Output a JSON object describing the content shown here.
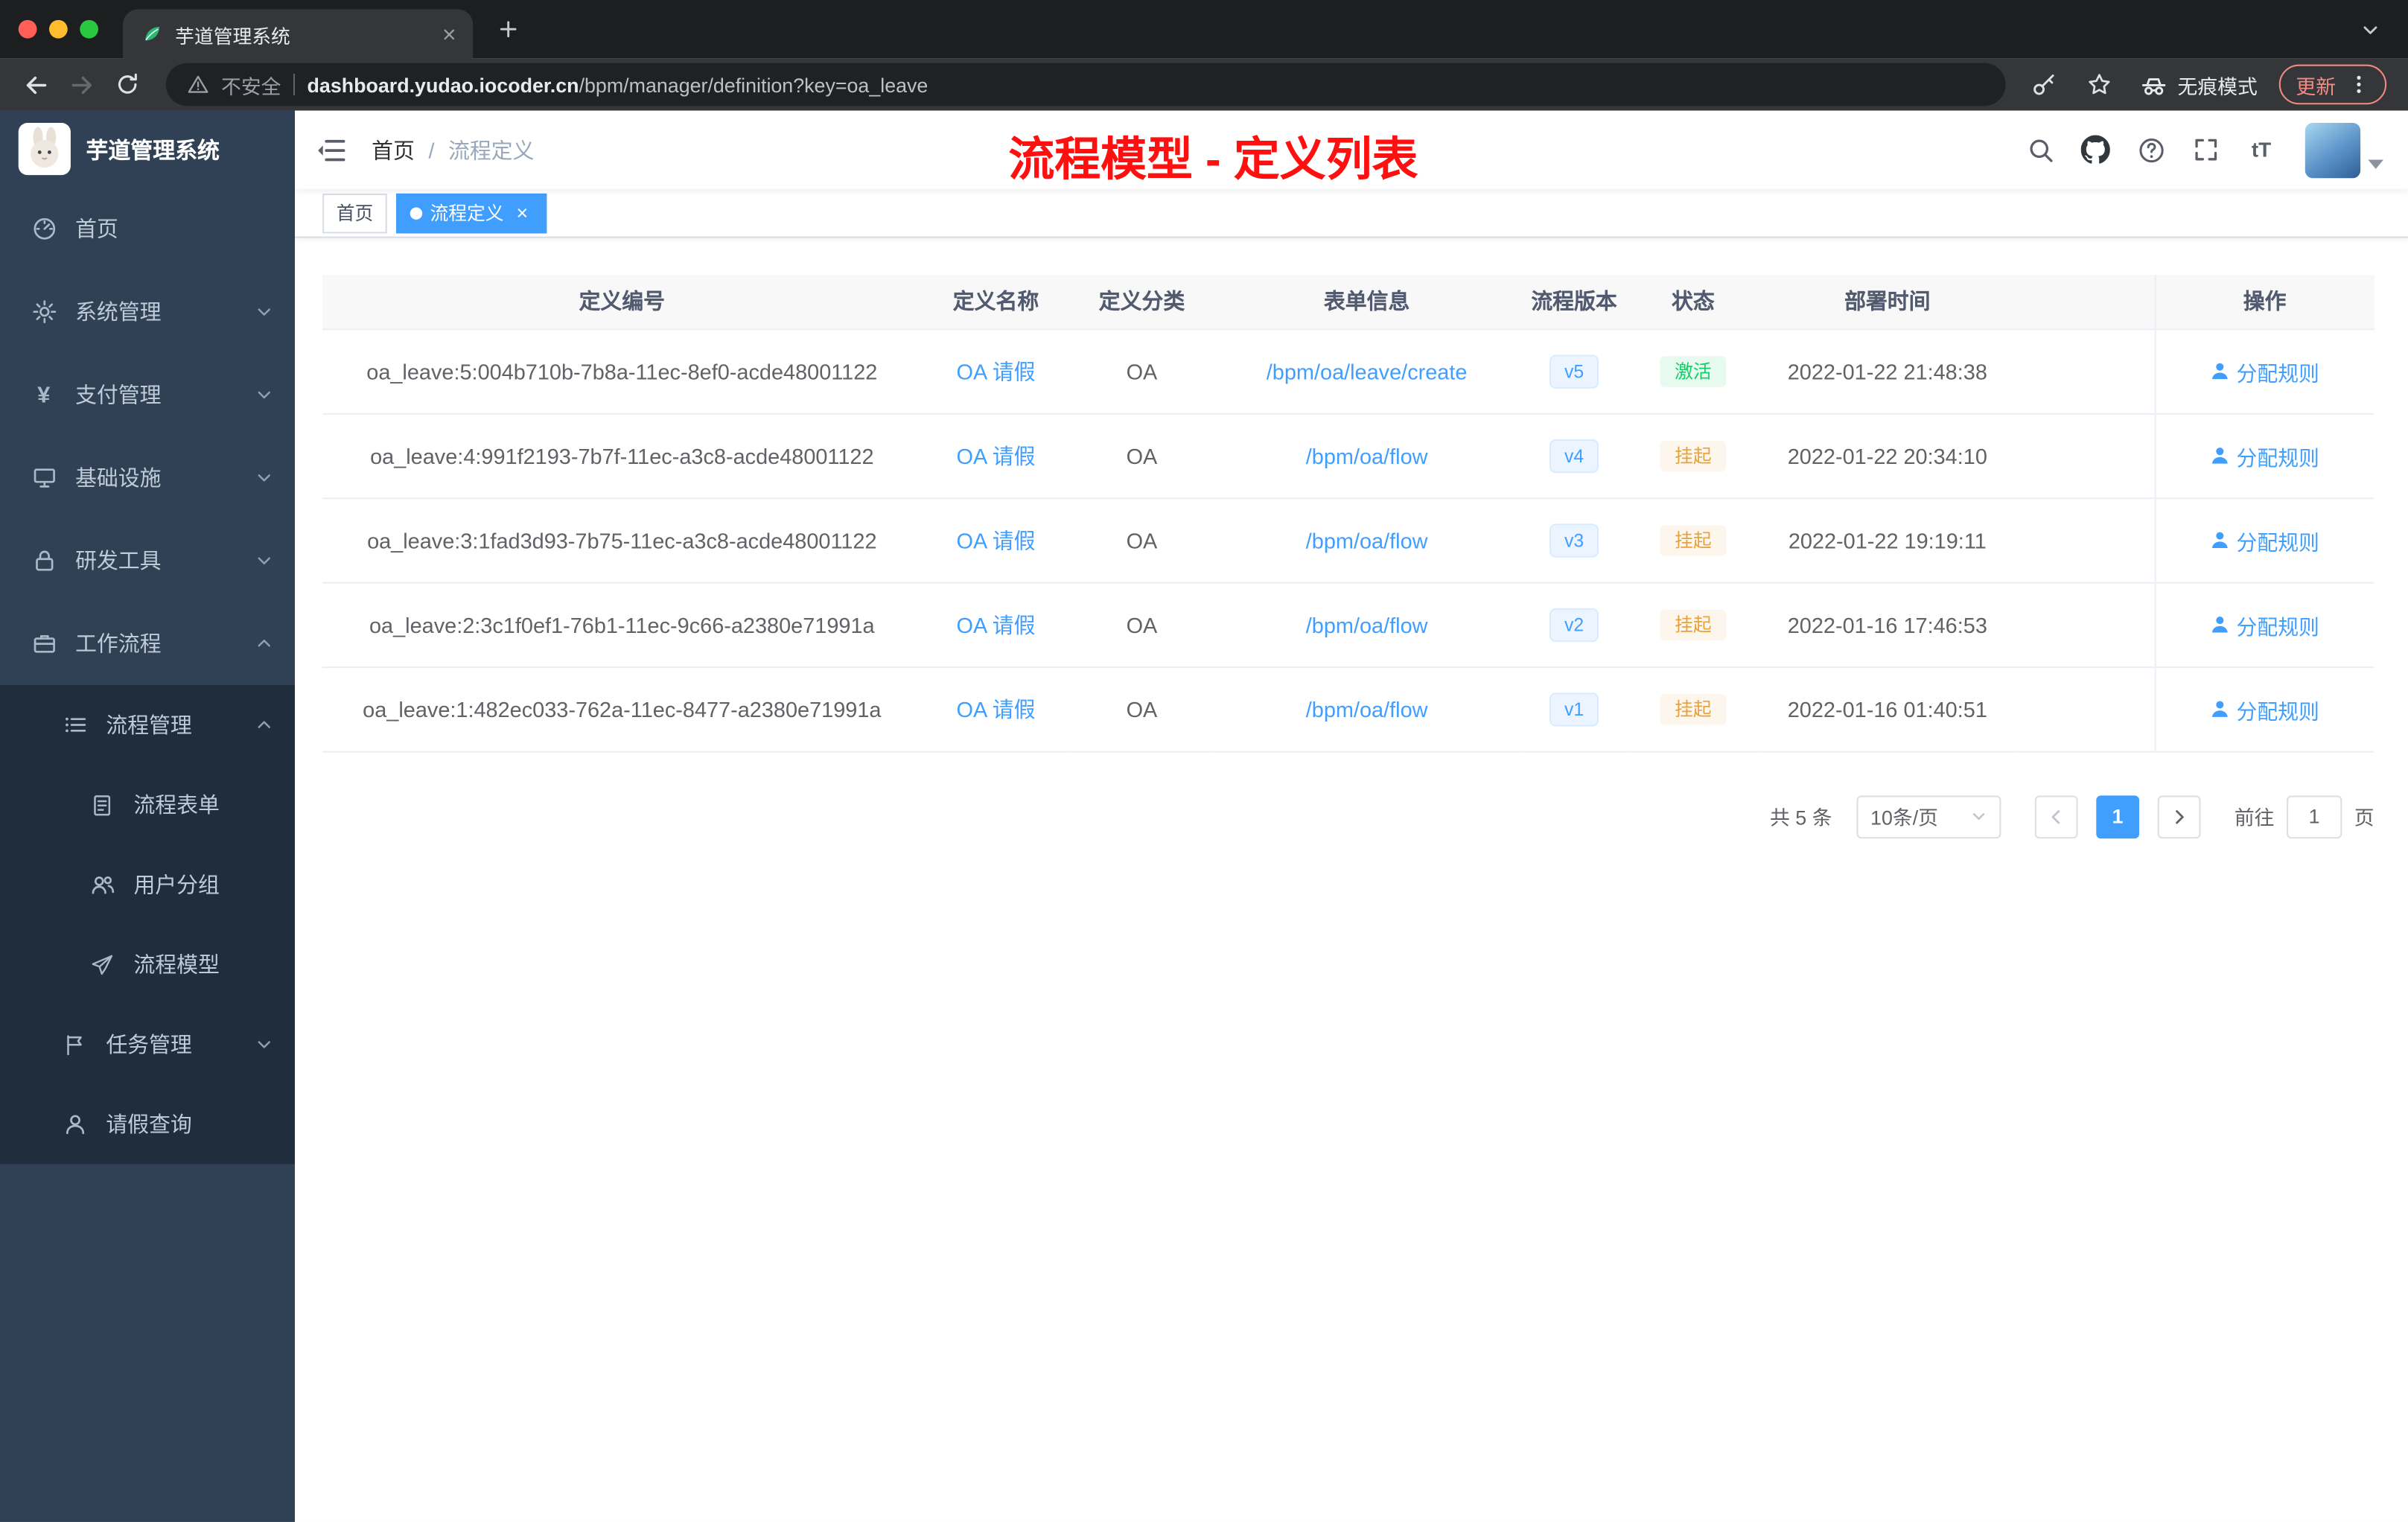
{
  "browser": {
    "tab_title": "芋道管理系统",
    "security_label": "不安全",
    "url_host": "dashboard.yudao.iocoder.cn",
    "url_path": "/bpm/manager/definition?key=oa_leave",
    "incognito_label": "无痕模式",
    "update_label": "更新"
  },
  "sidebar": {
    "app_title": "芋道管理系统",
    "items": [
      {
        "label": "首页"
      },
      {
        "label": "系统管理"
      },
      {
        "label": "支付管理"
      },
      {
        "label": "基础设施"
      },
      {
        "label": "研发工具"
      },
      {
        "label": "工作流程"
      },
      {
        "label": "流程管理"
      },
      {
        "label": "流程表单"
      },
      {
        "label": "用户分组"
      },
      {
        "label": "流程模型"
      },
      {
        "label": "任务管理"
      },
      {
        "label": "请假查询"
      }
    ]
  },
  "header": {
    "breadcrumb_home": "首页",
    "breadcrumb_sep": "/",
    "breadcrumb_current": "流程定义",
    "annotation": "流程模型 - 定义列表"
  },
  "tags": [
    {
      "label": "首页",
      "active": false
    },
    {
      "label": "流程定义",
      "active": true
    }
  ],
  "table": {
    "columns": [
      "定义编号",
      "定义名称",
      "定义分类",
      "表单信息",
      "流程版本",
      "状态",
      "部署时间",
      "操作"
    ],
    "rows": [
      {
        "id": "oa_leave:5:004b710b-7b8a-11ec-8ef0-acde48001122",
        "name": "OA 请假",
        "category": "OA",
        "form": "/bpm/oa/leave/create",
        "version": "v5",
        "status": "激活",
        "status_type": "success",
        "time": "2022-01-22 21:48:38",
        "action": "分配规则"
      },
      {
        "id": "oa_leave:4:991f2193-7b7f-11ec-a3c8-acde48001122",
        "name": "OA 请假",
        "category": "OA",
        "form": "/bpm/oa/flow",
        "version": "v4",
        "status": "挂起",
        "status_type": "warning",
        "time": "2022-01-22 20:34:10",
        "action": "分配规则"
      },
      {
        "id": "oa_leave:3:1fad3d93-7b75-11ec-a3c8-acde48001122",
        "name": "OA 请假",
        "category": "OA",
        "form": "/bpm/oa/flow",
        "version": "v3",
        "status": "挂起",
        "status_type": "warning",
        "time": "2022-01-22 19:19:11",
        "action": "分配规则"
      },
      {
        "id": "oa_leave:2:3c1f0ef1-76b1-11ec-9c66-a2380e71991a",
        "name": "OA 请假",
        "category": "OA",
        "form": "/bpm/oa/flow",
        "version": "v2",
        "status": "挂起",
        "status_type": "warning",
        "time": "2022-01-16 17:46:53",
        "action": "分配规则"
      },
      {
        "id": "oa_leave:1:482ec033-762a-11ec-8477-a2380e71991a",
        "name": "OA 请假",
        "category": "OA",
        "form": "/bpm/oa/flow",
        "version": "v1",
        "status": "挂起",
        "status_type": "warning",
        "time": "2022-01-16 01:40:51",
        "action": "分配规则"
      }
    ]
  },
  "pagination": {
    "total": "共 5 条",
    "page_size": "10条/页",
    "current_page": "1",
    "goto_label": "前往",
    "goto_value": "1",
    "unit_label": "页"
  },
  "colors": {
    "accent": "#409eff",
    "success": "#13ce66",
    "warning": "#e6a23c",
    "annotation_red": "#fe1010",
    "sidebar_bg": "#304156",
    "submenu_bg": "#1f2d3d"
  }
}
